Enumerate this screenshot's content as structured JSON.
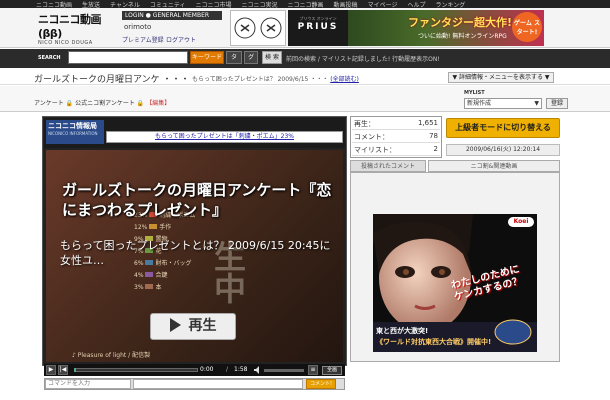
{
  "topnav": {
    "items": [
      "ニコニコ動画",
      "生放送",
      "チャンネル",
      "コミュニティ",
      "ニコニコ市場",
      "ニコニコ実況",
      "ニコニコ静画",
      "動画投稿",
      "マイページ",
      "ヘルプ",
      "ランキング"
    ]
  },
  "header": {
    "logo_main": "ニコニコ動画",
    "logo_version": "(ββ)",
    "logo_sub": "NICO NICO DOUGA",
    "login_tag": "LOGIN ● GENERAL MEMBER",
    "username": "orimoto",
    "premium_link": "プレミアム登録",
    "logout_link": "ログアウト"
  },
  "ads": {
    "prius_small": "プリウス オンライン",
    "prius_big": "PRIUS",
    "game_title": "ファンタジー超大作!",
    "game_sub": "ついに始動! 無料オンラインRPG",
    "game_start": "ゲーム スタート!"
  },
  "search": {
    "label": "SEARCH",
    "value": "",
    "keyword_btn": "キーワード",
    "tag_btn": "タ",
    "mylist_btn": "グ",
    "submit_btn": "検 索",
    "history_text": "前回の検索 / マイリスト記録しました! 行動履歴表示ON!"
  },
  "title_row": {
    "title": "ガールズトークの月曜日アンケ ・・・",
    "sub": "もらって困ったプレゼントは？ 2009/6/15 ・・・",
    "sub_link": "(全部読む)",
    "detail_btn": "▼ 詳細情報・メニューを表示する ▼"
  },
  "tag_row": {
    "links": [
      "アンケート",
      "公式ニコ割アンケート"
    ],
    "edit": "【編集】",
    "mylist_label": "MYLIST",
    "mylist_value": "新規作成",
    "register_btn": "登録"
  },
  "player": {
    "info_brand": "ニコニコ情報局",
    "info_sub": "NICONICO INFORMATION",
    "ticker": "もらって困ったプレゼントは「刺繍・ポエム」23%",
    "survey_rows": [
      {
        "pct": "23%",
        "label": "刺繍・ポエム"
      },
      {
        "pct": "12%",
        "label": "手作"
      },
      {
        "pct": "9%",
        "label": "置物"
      },
      {
        "pct": "7%",
        "label": "花"
      },
      {
        "pct": "6%",
        "label": "財布・バッグ"
      },
      {
        "pct": "4%",
        "label": "合鍵"
      },
      {
        "pct": "3%",
        "label": "本"
      }
    ],
    "overlay_title": "ガールズトークの月曜日アンケート『恋にまつわるプレゼント』",
    "overlay_sub": "もらって困ったプレゼントとは？ 2009/6/15 20:45に女性ユ…",
    "play_label": "再生",
    "watermark": "生中",
    "credit": "♪ Pleasure of light / 配信製",
    "time_now": "0:00",
    "time_sep": "/",
    "time_total": "1:58",
    "fullscreen": "全画",
    "comment_cmd_placeholder": "コマンドを入力",
    "comment_submit": "コメント!",
    "progress": 0.02
  },
  "stats": {
    "rows": [
      {
        "k": "再生：",
        "v": "1,651"
      },
      {
        "k": "コメント：",
        "v": "78"
      },
      {
        "k": "マイリスト：",
        "v": "2"
      }
    ],
    "upper_mode_btn": "上級者モードに切り替える",
    "date": "2009/06/16(火) 12:20:14"
  },
  "tabs": [
    "投稿されたコメント",
    "ニコ割&関連動画"
  ],
  "koei_ad": {
    "logo": "Koei",
    "copy_line1": "わたしのために",
    "copy_line2": "ケンカするの？",
    "banner1": "東と西が大激突!",
    "banner2": "《ワールド対抗東西大合戦》開催中!"
  }
}
